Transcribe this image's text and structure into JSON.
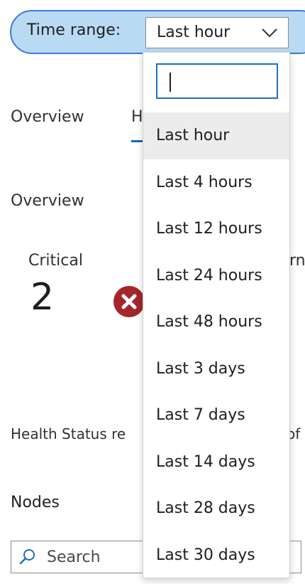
{
  "time_range": {
    "label": "Time range:",
    "selected": "Last hour"
  },
  "dropdown": {
    "search_value": "",
    "options": [
      {
        "label": "Last hour",
        "selected": true
      },
      {
        "label": "Last 4 hours"
      },
      {
        "label": "Last 12 hours"
      },
      {
        "label": "Last 24 hours"
      },
      {
        "label": "Last 48 hours"
      },
      {
        "label": "Last 3 days"
      },
      {
        "label": "Last 7 days"
      },
      {
        "label": "Last 14 days"
      },
      {
        "label": "Last 28 days"
      },
      {
        "label": "Last 30 days"
      }
    ]
  },
  "tabs": {
    "overview": "Overview",
    "health_partial": "H"
  },
  "overview": {
    "title": "Overview",
    "critical_label": "Critical",
    "critical_count": "2",
    "warning_partial": "rn"
  },
  "health_status": {
    "visible_prefix": "Health Status re",
    "visible_suffix": "of"
  },
  "nodes": {
    "title": "Nodes",
    "search_placeholder": "Search"
  },
  "colors": {
    "pill_background": "#b9daf3",
    "pill_border": "#3a7bd5",
    "error_red": "#a4262c",
    "accent_blue": "#0f6cbd",
    "selected_option_background": "#ececec"
  },
  "icons": {
    "dropdown": "chevron-down-icon",
    "critical": "error-circle-icon",
    "search": "search-icon"
  }
}
